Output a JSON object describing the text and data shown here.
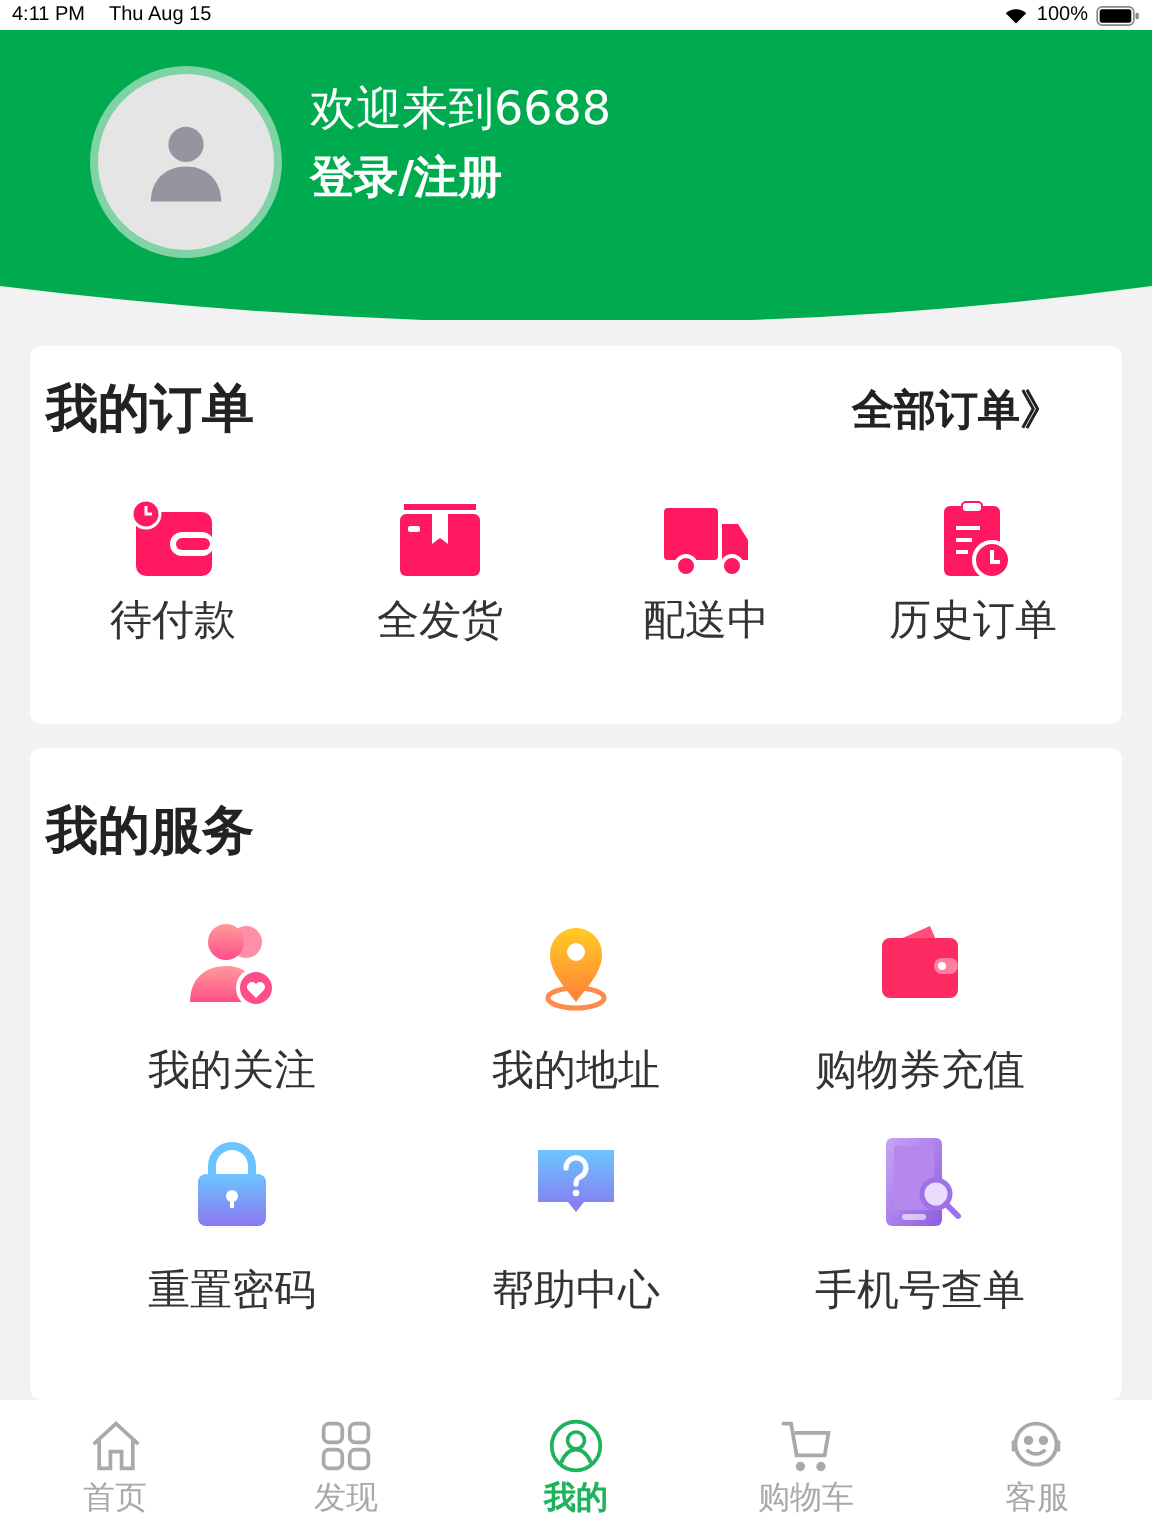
{
  "status_bar": {
    "time": "4:11 PM",
    "date": "Thu Aug 15",
    "battery": "100%"
  },
  "profile": {
    "welcome": "欢迎来到6688",
    "login": "登录/注册"
  },
  "orders": {
    "title": "我的订单",
    "all_link": "全部订单》",
    "items": [
      {
        "label": "待付款"
      },
      {
        "label": "全发货"
      },
      {
        "label": "配送中"
      },
      {
        "label": "历史订单"
      }
    ]
  },
  "services": {
    "title": "我的服务",
    "items": [
      {
        "label": "我的关注"
      },
      {
        "label": "我的地址"
      },
      {
        "label": "购物券充值"
      },
      {
        "label": "重置密码"
      },
      {
        "label": "帮助中心"
      },
      {
        "label": "手机号查单"
      }
    ]
  },
  "tab_bar": [
    {
      "label": "首页",
      "selected": false
    },
    {
      "label": "发现",
      "selected": false
    },
    {
      "label": "我的",
      "selected": true
    },
    {
      "label": "购物车",
      "selected": false
    },
    {
      "label": "客服",
      "selected": false
    }
  ]
}
